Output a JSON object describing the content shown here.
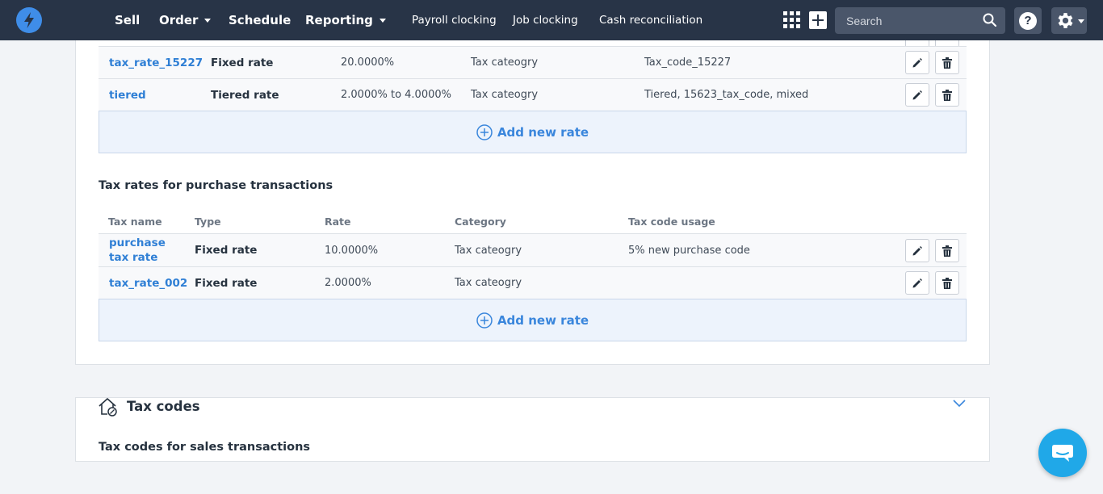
{
  "nav": {
    "main_items": [
      {
        "label": "Sell",
        "dropdown": false
      },
      {
        "label": "Order",
        "dropdown": true
      },
      {
        "label": "Schedule",
        "dropdown": false
      },
      {
        "label": "Reporting",
        "dropdown": true
      }
    ],
    "sub_items": [
      "Payroll clocking",
      "Job clocking",
      "Cash reconciliation"
    ],
    "search_placeholder": "Search",
    "help_label": "?"
  },
  "sales_rows": [
    {
      "name": "tax_rate_15227",
      "type": "Fixed rate",
      "rate": "20.0000%",
      "category": "Tax cateogry",
      "usage": "Tax_code_15227"
    },
    {
      "name": "tiered",
      "type": "Tiered rate",
      "rate": "2.0000% to 4.0000%",
      "category": "Tax cateogry",
      "usage": "Tiered, 15623_tax_code, mixed"
    }
  ],
  "add_rate_label": "Add new rate",
  "purchase": {
    "title": "Tax rates for purchase transactions",
    "headers": {
      "name": "Tax name",
      "type": "Type",
      "rate": "Rate",
      "category": "Category",
      "usage": "Tax code usage"
    },
    "rows": [
      {
        "name": "purchase tax rate",
        "type": "Fixed rate",
        "rate": "10.0000%",
        "category": "Tax cateogry",
        "usage": "5% new purchase code"
      },
      {
        "name": "tax_rate_002",
        "type": "Fixed rate",
        "rate": "2.0000%",
        "category": "Tax cateogry",
        "usage": ""
      }
    ]
  },
  "tax_codes": {
    "title": "Tax codes",
    "subtitle": "Tax codes for sales transactions"
  },
  "colors": {
    "nav_bg": "#283447",
    "link": "#2f7fd5",
    "accent": "#3a86dc",
    "chat": "#20a8e8"
  },
  "icons": [
    "bolt-logo-icon",
    "apps-grid-icon",
    "plus-icon",
    "search-icon",
    "help-icon",
    "gear-icon",
    "pencil-icon",
    "trash-icon",
    "plus-circle-icon",
    "tax-codes-icon",
    "chevron-down-icon",
    "chat-icon"
  ]
}
